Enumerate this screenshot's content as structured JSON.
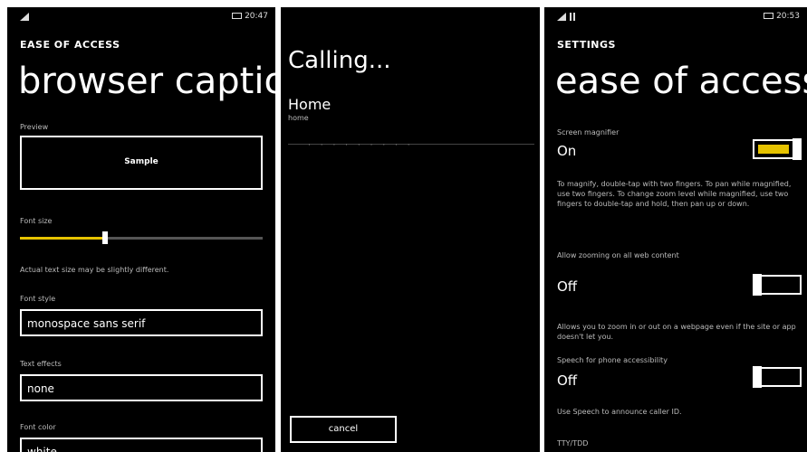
{
  "screens": {
    "captions": {
      "status": {
        "time": "20:47"
      },
      "app_title": "EASE OF ACCESS",
      "page_title": "browser captio",
      "preview_label": "Preview",
      "preview_sample": "Sample",
      "font_size_label": "Font size",
      "font_size_value": 0.35,
      "font_size_hint": "Actual text size may be slightly different.",
      "font_style_label": "Font style",
      "font_style_value": "monospace sans serif",
      "text_effects_label": "Text effects",
      "text_effects_value": "none",
      "font_color_label": "Font color",
      "font_color_value": "white"
    },
    "calling": {
      "title": "Calling...",
      "contact_name": "Home",
      "contact_sub": "home",
      "cancel_label": "cancel"
    },
    "settings": {
      "status": {
        "time": "20:53"
      },
      "app_title": "SETTINGS",
      "page_title": "ease of access",
      "magnifier_label": "Screen magnifier",
      "magnifier_state": "On",
      "magnifier_desc": "To magnify, double-tap with two fingers. To pan while magnified, use two fingers. To change zoom level while magnified, use two fingers to double-tap and hold, then pan up or down.",
      "zoom_label": "Allow zooming on all web content",
      "zoom_state": "Off",
      "zoom_desc": "Allows you to zoom in or out on a webpage even if the site or app doesn't let you.",
      "speech_label": "Speech for phone accessibility",
      "speech_state": "Off",
      "speech_desc": "Use Speech to announce caller ID.",
      "tty_label": "TTY/TDD"
    }
  },
  "colors": {
    "accent": "#e6c300",
    "background": "#000000",
    "foreground": "#ffffff"
  },
  "icons": [
    "signal-icon",
    "battery-icon"
  ]
}
